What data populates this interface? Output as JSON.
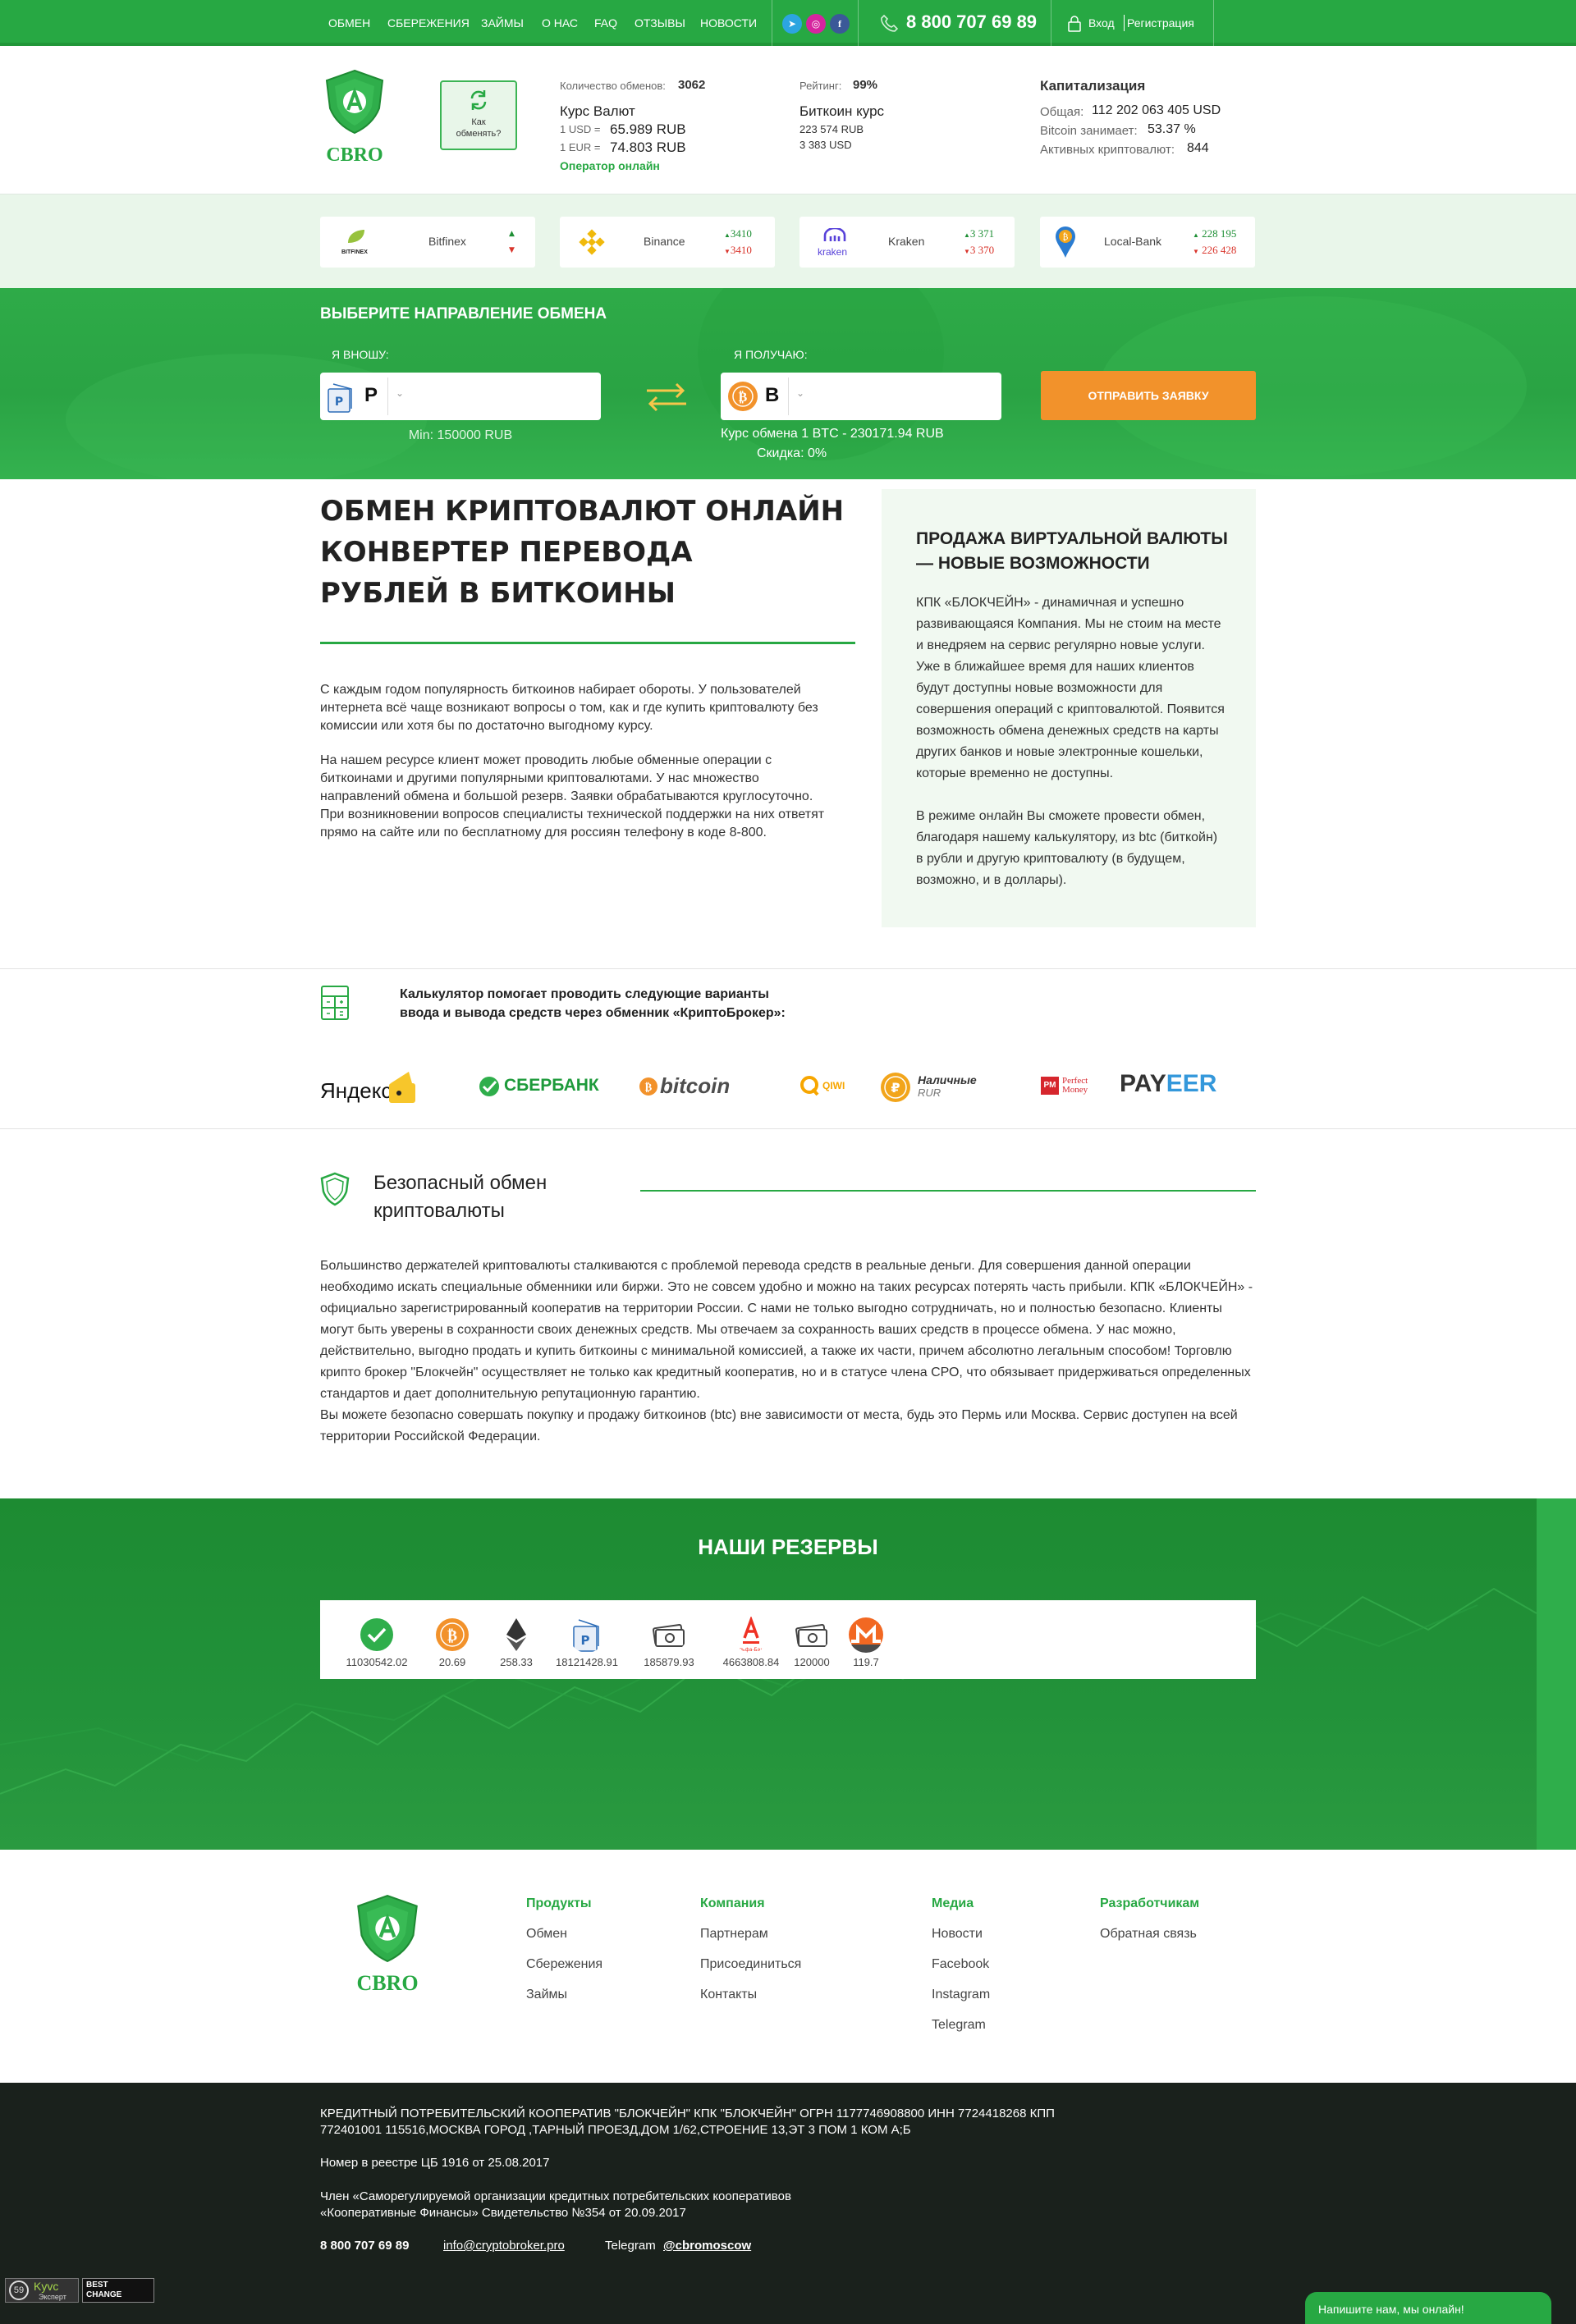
{
  "nav": {
    "items": [
      "ОБМЕН",
      "СБЕРЕЖЕНИЯ",
      "ЗАЙМЫ",
      "О НАС",
      "FAQ",
      "ОТЗЫВЫ",
      "НОВОСТИ"
    ],
    "phone": "8 800 707 69 89",
    "login": "Вход",
    "register": "Регистрация"
  },
  "header": {
    "logo_text": "CBRO",
    "how_to": "Как обменять?",
    "exchanges_label": "Количество обменов:",
    "exchanges_count": "3062",
    "rates_title": "Курс Валют",
    "usd_label": "1 USD =",
    "usd_value": "65.989 RUB",
    "eur_label": "1 EUR =",
    "eur_value": "74.803 RUB",
    "operator": "Оператор онлайн",
    "rating_label": "Рейтинг:",
    "rating_value": "99%",
    "btc_title": "Биткоин курс",
    "btc_rub": "223 574 RUB",
    "btc_usd": "3 383 USD",
    "cap_title": "Капитализация",
    "cap_total_label": "Общая:",
    "cap_total_value": "112 202 063 405 USD",
    "cap_btc_label": "Bitcoin занимает:",
    "cap_btc_value": "53.37 %",
    "cap_active_label": "Активных криптовалют:",
    "cap_active_value": "844"
  },
  "exchanges": [
    {
      "logo": "BITFINEX",
      "name": "Bitfinex",
      "up": "",
      "down": ""
    },
    {
      "logo": "",
      "name": "Binance",
      "up": "3410",
      "down": "3410"
    },
    {
      "logo": "kraken",
      "name": "Kraken",
      "up": "3 371",
      "down": "3 370"
    },
    {
      "logo": "",
      "name": "Local-Bank",
      "up": "228 195",
      "down": "226 428"
    }
  ],
  "hero": {
    "title": "ВЫБЕРИТЕ НАПРАВЛЕНИЕ ОБМЕНА",
    "give_label": "Я ВНОШУ:",
    "give_currency": "P",
    "receive_label": "Я ПОЛУЧАЮ:",
    "receive_currency": "B",
    "min": "Min: 150000 RUB",
    "rate": "Курс обмена 1 BTC - 230171.94 RUB",
    "discount": "Скидка: 0%",
    "submit": "ОТПРАВИТЬ ЗАЯВКУ"
  },
  "main": {
    "title_l1": "ОБМЕН КРИПТОВАЛЮТ ОНЛАЙН",
    "title_l2": "КОНВЕРТЕР ПЕРЕВОДА",
    "title_l3": "РУБЛЕЙ В БИТКОИНЫ",
    "p1": "С каждым годом популярность биткоинов набирает обороты. У пользователей интернета всё чаще возникают вопросы о том, как и где купить криптовалюту без комиссии или хотя бы по достаточно выгодному курсу.",
    "p2": "На нашем ресурсе клиент может проводить любые обменные операции с биткоинами и другими популярными криптовалютами. У нас множество направлений обмена и большой резерв. Заявки обрабатываются круглосуточно. При возникновении вопросов специалисты технической поддержки на них ответят прямо на сайте или по бесплатному для россиян телефону в коде 8-800."
  },
  "side": {
    "title": "ПРОДАЖА ВИРТУАЛЬНОЙ ВАЛЮТЫ — НОВЫЕ ВОЗМОЖНОСТИ",
    "p1": "КПК «БЛОКЧЕЙН» - динамичная и успешно развивающаяся Компания. Мы не стоим на месте и внедряем на сервис регулярно новые услуги. Уже в ближайшее время для наших клиентов будут доступны новые возможности для совершения операций с криптовалютой. Появится возможность обмена денежных средств на карты других банков и новые электронные кошельки, которые временно не доступны.",
    "p2": "В режиме онлайн Вы сможете провести обмен, благодаря нашему калькулятору, из btc (биткойн) в рубли и другую криптовалюту (в будущем, возможно, и в доллары)."
  },
  "calc": {
    "text_l1": "Калькулятор помогает проводить следующие варианты",
    "text_l2": "ввода и вывода средств через обменник «КриптоБрокер»:",
    "payments": [
      "Яндекс",
      "СБЕРБАНК",
      "bitcoin",
      "QIWI",
      "Наличные",
      "RUR",
      "PM",
      "Perfect Money",
      "PAY",
      "EER"
    ]
  },
  "secure": {
    "title_l1": "Безопасный обмен",
    "title_l2": "криптовалюты",
    "p1": "Большинство держателей криптовалюты сталкиваются с проблемой перевода средств в реальные деньги. Для совершения данной операции необходимо искать специальные обменники или биржи. Это не совсем удобно и можно на таких ресурсах потерять часть прибыли. КПК «БЛОКЧЕЙН» - официально зарегистрированный кооператив на территории России. С нами не только выгодно сотрудничать, но и полностью безопасно. Клиенты могут быть уверены в сохранности своих денежных средств. Мы отвечаем за сохранность ваших средств в процессе обмена. У нас можно, действительно, выгодно продать и купить биткоины с минимальной комиссией, а также их части, причем абсолютно легальным способом! Торговлю крипто брокер \"Блокчейн\" осуществляет не только как кредитный кооператив, но и в статусе члена СРО, что обязывает придерживаться определенных стандартов и дает дополнительную репутационную гарантию.",
    "p2": "Вы можете безопасно совершать покупку и продажу биткоинов (btc) вне зависимости от места, будь это Пермь или Москва. Сервис доступен на всей территории Российской Федерации."
  },
  "reserves": {
    "title": "НАШИ РЕЗЕРВЫ",
    "items": [
      {
        "icon": "sberbank-icon",
        "value": "11030542.02"
      },
      {
        "icon": "bitcoin-icon",
        "value": "20.69"
      },
      {
        "icon": "ethereum-icon",
        "value": "258.33"
      },
      {
        "icon": "wallet-icon",
        "value": "18121428.91"
      },
      {
        "icon": "cash-icon",
        "value": "185879.93"
      },
      {
        "icon": "alfabank-icon",
        "value": "4663808.84"
      },
      {
        "icon": "cash-icon",
        "value": "120000"
      },
      {
        "icon": "monero-icon",
        "value": "119.7"
      }
    ],
    "alfa_text": "Альфа-Банк"
  },
  "footer": {
    "logo_text": "CBRO",
    "cols": [
      {
        "title": "Продукты",
        "links": [
          "Обмен",
          "Сбережения",
          "Займы"
        ]
      },
      {
        "title": "Компания",
        "links": [
          "Партнерам",
          "Присоединиться",
          "Контакты"
        ]
      },
      {
        "title": "Медиа",
        "links": [
          "Новости",
          "Facebook",
          "Instagram",
          "Telegram"
        ]
      },
      {
        "title": "Разработчикам",
        "links": [
          "Обратная связь"
        ]
      }
    ],
    "legal_l1": "КРЕДИТНЫЙ ПОТРЕБИТЕЛЬСКИЙ КООПЕРАТИВ \"БЛОКЧЕЙН\" КПК \"БЛОКЧЕЙН\" ОГРН 1177746908800 ИНН 7724418268 КПП",
    "legal_l2": "772401001 115516,МОСКВА ГОРОД ,ТАРНЫЙ ПРОЕЗД,ДОМ 1/62,СТРОЕНИЕ 13,ЭТ 3 ПОМ 1 КОМ А;Б",
    "registry": "Номер в реестре ЦБ 1916 от 25.08.2017",
    "member_l1": "Член «Саморегулируемой организации кредитных потребительских кооперативов",
    "member_l2": "«Кооперативные Финансы» Свидетельство №354 от 20.09.2017",
    "phone": "8 800 707 69 89",
    "email": "info@cryptobroker.pro",
    "telegram_label": "Telegram",
    "telegram_handle": "@cbromoscow",
    "badge1": "Kyvc",
    "badge1_sub": "Эксперт",
    "badge2": "BEST",
    "badge2_b": "CHANGE",
    "chat": "Напишите нам, мы онлайн!"
  },
  "colors": {
    "green": "#27a843",
    "dark_green": "#1d8b32",
    "orange": "#f2922b",
    "footer_bg": "#1a211c"
  }
}
